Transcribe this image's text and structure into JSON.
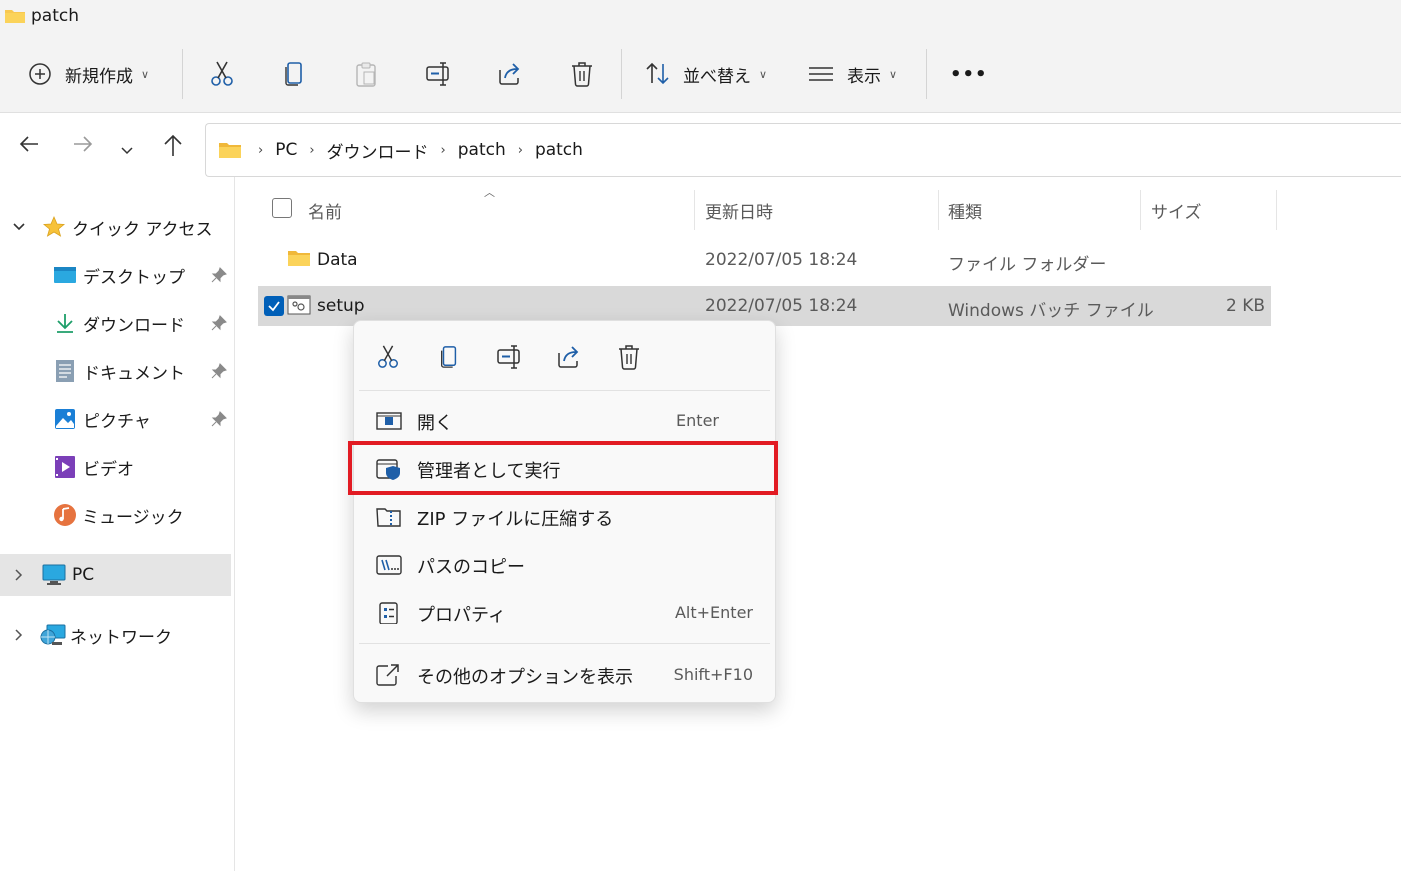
{
  "window": {
    "title": "patch"
  },
  "toolbar": {
    "new_label": "新規作成",
    "sort_label": "並べ替え",
    "view_label": "表示",
    "more_label": "•••"
  },
  "address": {
    "crumbs": [
      "PC",
      "ダウンロード",
      "patch",
      "patch"
    ]
  },
  "sidebar": {
    "quick_access": "クイック アクセス",
    "items": [
      {
        "label": "デスクトップ"
      },
      {
        "label": "ダウンロード"
      },
      {
        "label": "ドキュメント"
      },
      {
        "label": "ピクチャ"
      },
      {
        "label": "ビデオ"
      },
      {
        "label": "ミュージック"
      }
    ],
    "pc": "PC",
    "network": "ネットワーク"
  },
  "columns": {
    "name": "名前",
    "modified": "更新日時",
    "type": "種類",
    "size": "サイズ"
  },
  "files": [
    {
      "name": "Data",
      "modified": "2022/07/05 18:24",
      "type": "ファイル フォルダー",
      "size": ""
    },
    {
      "name": "setup",
      "modified": "2022/07/05 18:24",
      "type": "Windows バッチ ファイル",
      "size": "2 KB"
    }
  ],
  "context_menu": {
    "items": [
      {
        "label": "開く",
        "shortcut": "Enter"
      },
      {
        "label": "管理者として実行",
        "shortcut": ""
      },
      {
        "label": "ZIP ファイルに圧縮する",
        "shortcut": ""
      },
      {
        "label": "パスのコピー",
        "shortcut": ""
      },
      {
        "label": "プロパティ",
        "shortcut": "Alt+Enter"
      },
      {
        "label": "その他のオプションを表示",
        "shortcut": "Shift+F10"
      }
    ]
  },
  "colors": {
    "accent": "#005fb8",
    "highlight_box": "#e21b23",
    "folder": "#f8c850"
  }
}
